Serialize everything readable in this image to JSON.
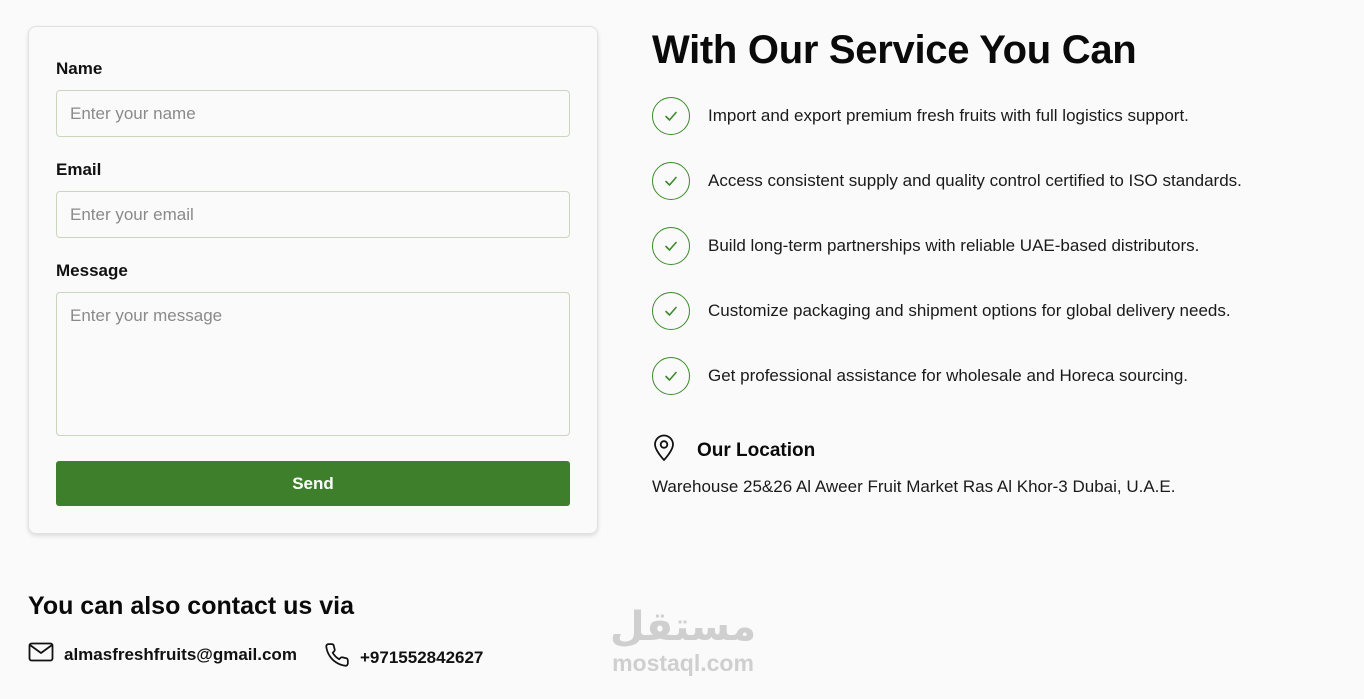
{
  "form": {
    "name_label": "Name",
    "name_placeholder": "Enter your name",
    "email_label": "Email",
    "email_placeholder": "Enter your email",
    "message_label": "Message",
    "message_placeholder": "Enter your message",
    "send_label": "Send"
  },
  "services": {
    "title": "With Our Service You Can",
    "items": [
      {
        "icon": "check-icon",
        "text": "Import and export premium fresh fruits with full logistics support."
      },
      {
        "icon": "check-icon",
        "text": "Access consistent supply and quality control certified to ISO standards."
      },
      {
        "icon": "check-icon",
        "text": "Build long-term partnerships with reliable UAE-based distributors."
      },
      {
        "icon": "check-icon",
        "text": "Customize packaging and shipment options for global delivery needs."
      },
      {
        "icon": "check-icon",
        "text": "Get professional assistance for wholesale and Horeca sourcing."
      }
    ]
  },
  "location": {
    "icon": "map-pin-icon",
    "title": "Our Location",
    "address": "Warehouse 25&26 Al Aweer Fruit Market Ras Al Khor-3 Dubai, U.A.E."
  },
  "contact": {
    "title": "You can also contact us via",
    "email_icon": "mail-icon",
    "email": "almasfreshfruits@gmail.com",
    "phone_icon": "phone-icon",
    "phone": "+971552842627"
  },
  "watermark": {
    "arabic": "مستقل",
    "latin": "mostaql.com"
  },
  "colors": {
    "accent": "#3e7f2c",
    "check_border": "#3e8a2c",
    "background": "#fafafa"
  }
}
